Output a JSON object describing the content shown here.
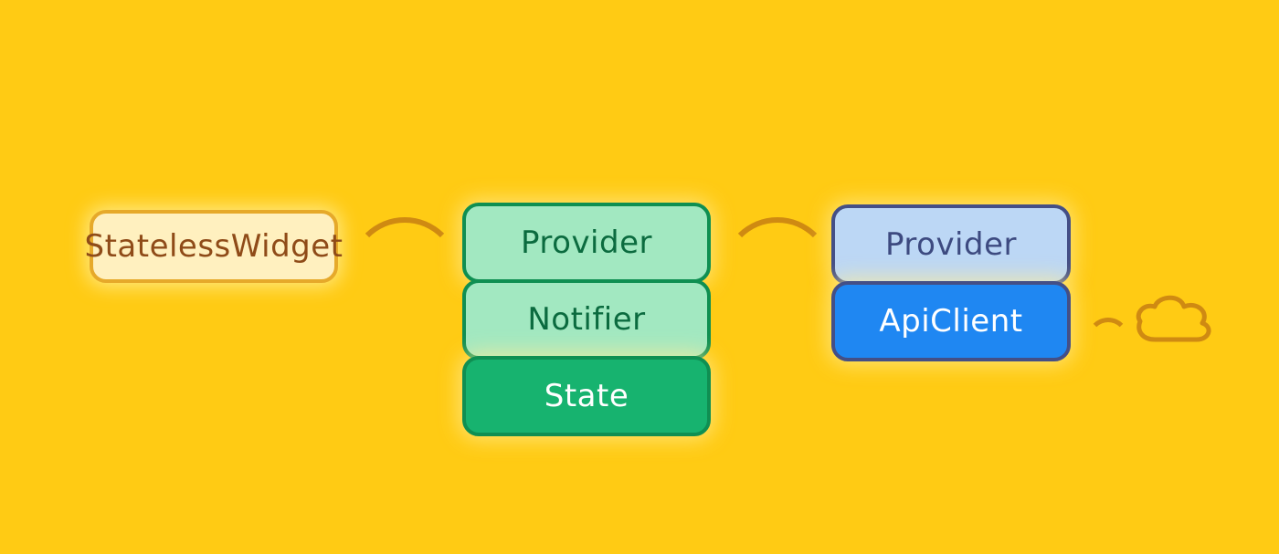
{
  "widget": {
    "label": "StatelessWidget"
  },
  "green_stack": {
    "provider": "Provider",
    "notifier": "Notifier",
    "state": "State"
  },
  "blue_stack": {
    "provider": "Provider",
    "client": "ApiClient"
  },
  "colors": {
    "bg": "#ffcb14",
    "widget_fill": "#fff0bf",
    "widget_border": "#e6a92a",
    "widget_text": "#8f4b18",
    "green_light": "#a2e8c1",
    "green_dark": "#17b36f",
    "green_border": "#0f8f52",
    "green_text": "#0b6b3f",
    "blue_light": "#bcd7f5",
    "blue_dark": "#1f87f2",
    "blue_border": "#444f86",
    "blue_text": "#3d4a80",
    "connector": "#cf8a12"
  }
}
